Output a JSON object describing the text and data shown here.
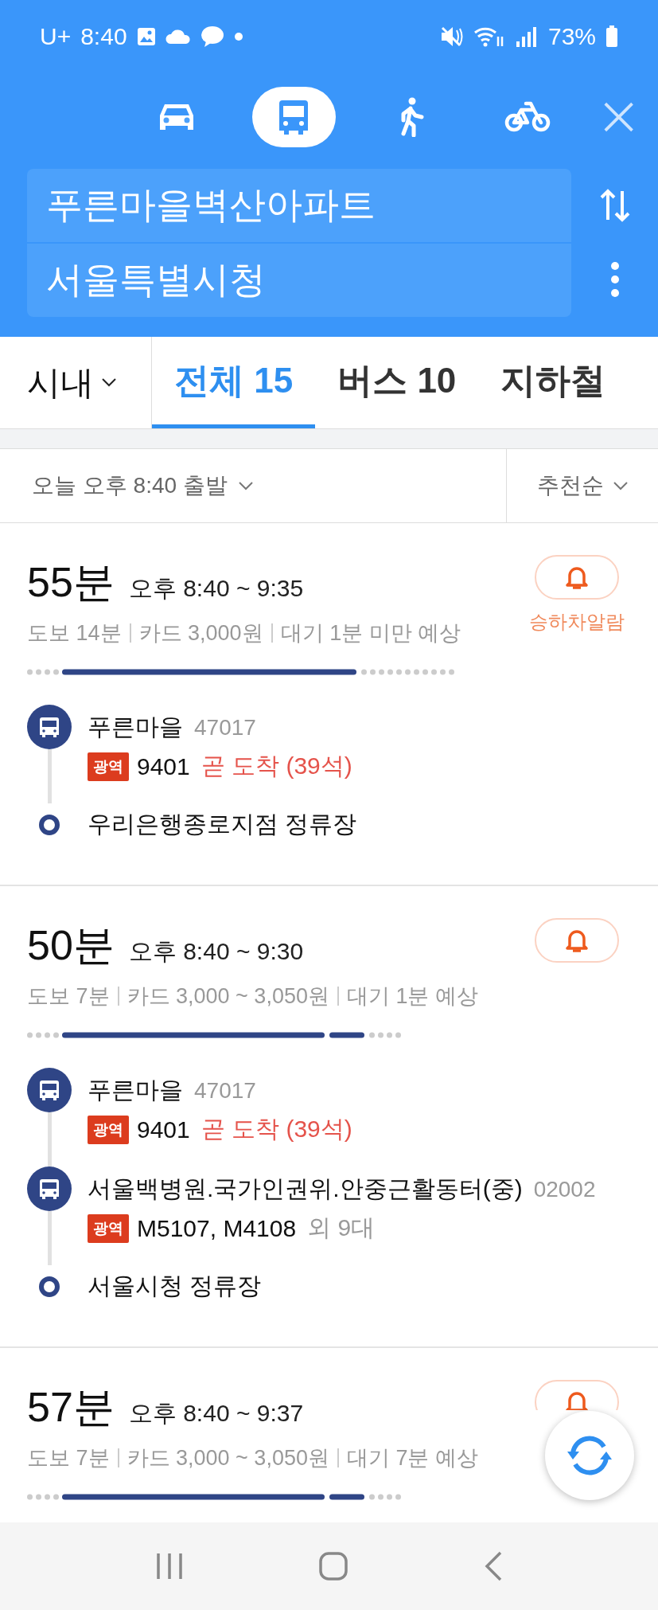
{
  "status_bar": {
    "carrier": "U+",
    "time": "8:40",
    "battery": "73%"
  },
  "modes": [
    {
      "kind": "car",
      "selected": false
    },
    {
      "kind": "bus",
      "selected": true
    },
    {
      "kind": "walk",
      "selected": false
    },
    {
      "kind": "bike",
      "selected": false
    }
  ],
  "origin": {
    "value": "푸른마을벽산아파트"
  },
  "destination": {
    "value": "서울특별시청"
  },
  "region": {
    "label": "시내"
  },
  "tabs": [
    {
      "label": "전체 15",
      "selected": true
    },
    {
      "label": "버스 10",
      "selected": false
    },
    {
      "label": "지하철",
      "selected": false
    }
  ],
  "filter": {
    "departure": "오늘 오후 8:40 출발",
    "sort": "추천순"
  },
  "routes": [
    {
      "duration": "55분",
      "times": "오후 8:40 ~ 9:35",
      "meta": [
        "도보 14분",
        "카드 3,000원",
        "대기 1분 미만 예상"
      ],
      "alarm_label": "승하차알람",
      "bar": [
        {
          "kind": "walk"
        },
        {
          "kind": "bus"
        },
        {
          "kind": "walk-long"
        }
      ],
      "steps": [
        {
          "kind": "bus",
          "stop": "푸른마을",
          "stop_id": "47017",
          "badge": "광역",
          "route": "9401",
          "arrival": "곧 도착 (39석)"
        },
        {
          "kind": "end",
          "stop": "우리은행종로지점 정류장"
        }
      ]
    },
    {
      "duration": "50분",
      "times": "오후 8:40 ~ 9:30",
      "meta": [
        "도보 7분",
        "카드 3,000 ~ 3,050원",
        "대기 1분 예상"
      ],
      "bar": [
        {
          "kind": "walk"
        },
        {
          "kind": "bus"
        },
        {
          "kind": "bus-short"
        },
        {
          "kind": "walk"
        }
      ],
      "steps": [
        {
          "kind": "bus",
          "stop": "푸른마을",
          "stop_id": "47017",
          "badge": "광역",
          "route": "9401",
          "arrival": "곧 도착 (39석)"
        },
        {
          "kind": "bus",
          "stop": "서울백병원.국가인권위.안중근활동터(중)",
          "stop_id": "02002",
          "badge": "광역",
          "route": "M5107, M4108",
          "extra": "외 9대"
        },
        {
          "kind": "end",
          "stop": "서울시청 정류장"
        }
      ]
    },
    {
      "duration": "57분",
      "times": "오후 8:40 ~ 9:37",
      "meta": [
        "도보 7분",
        "카드 3,000 ~ 3,050원",
        "대기 7분 예상"
      ],
      "bar": [
        {
          "kind": "walk"
        },
        {
          "kind": "bus"
        },
        {
          "kind": "bus-short"
        },
        {
          "kind": "walk"
        }
      ]
    }
  ]
}
